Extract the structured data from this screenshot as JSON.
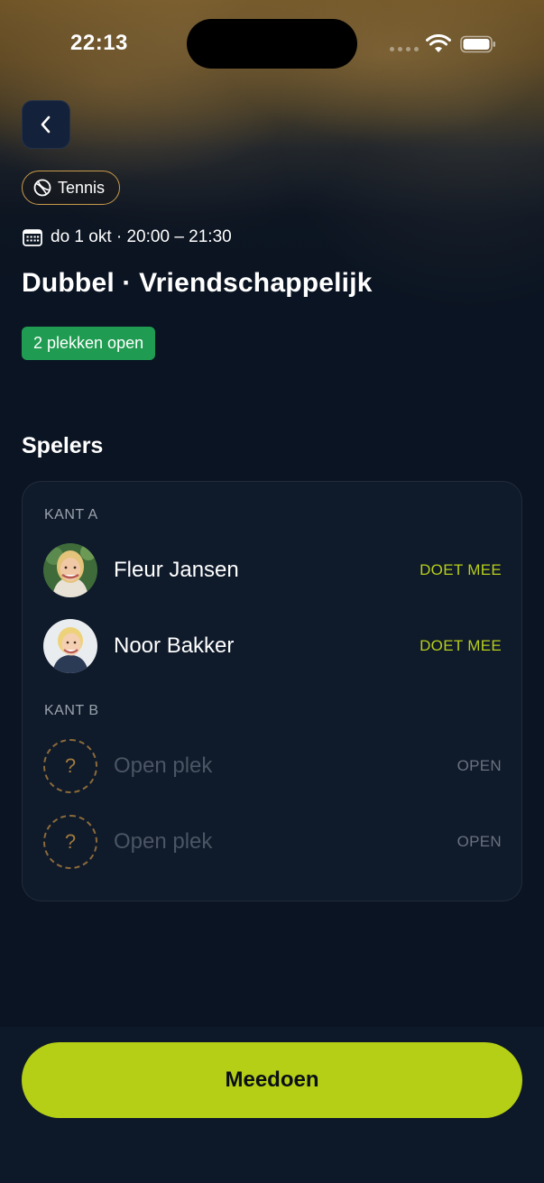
{
  "status_bar": {
    "time": "22:13"
  },
  "header": {
    "sport": "Tennis",
    "date_time": "do 1 okt · 20:00 – 21:30",
    "title": "Dubbel · Vriendschappelijk",
    "spots_badge": "2 plekken open"
  },
  "players_section": {
    "title": "Spelers",
    "sides": [
      {
        "label": "KANT A",
        "players": [
          {
            "name": "Fleur Jansen",
            "status": "DOET MEE"
          },
          {
            "name": "Noor Bakker",
            "status": "DOET MEE"
          }
        ]
      },
      {
        "label": "KANT B",
        "players": [
          {
            "name": "Open plek",
            "status": "OPEN",
            "placeholder": "?"
          },
          {
            "name": "Open plek",
            "status": "OPEN",
            "placeholder": "?"
          }
        ]
      }
    ]
  },
  "action": {
    "join_label": "Meedoen"
  },
  "colors": {
    "accent": "#b5cf16",
    "badge_green": "#1f9c52",
    "chip_border": "#c99a4a",
    "background": "#0b1422"
  },
  "icons": [
    "back-chevron-icon",
    "tennis-ball-icon",
    "calendar-icon",
    "wifi-icon",
    "battery-icon"
  ]
}
